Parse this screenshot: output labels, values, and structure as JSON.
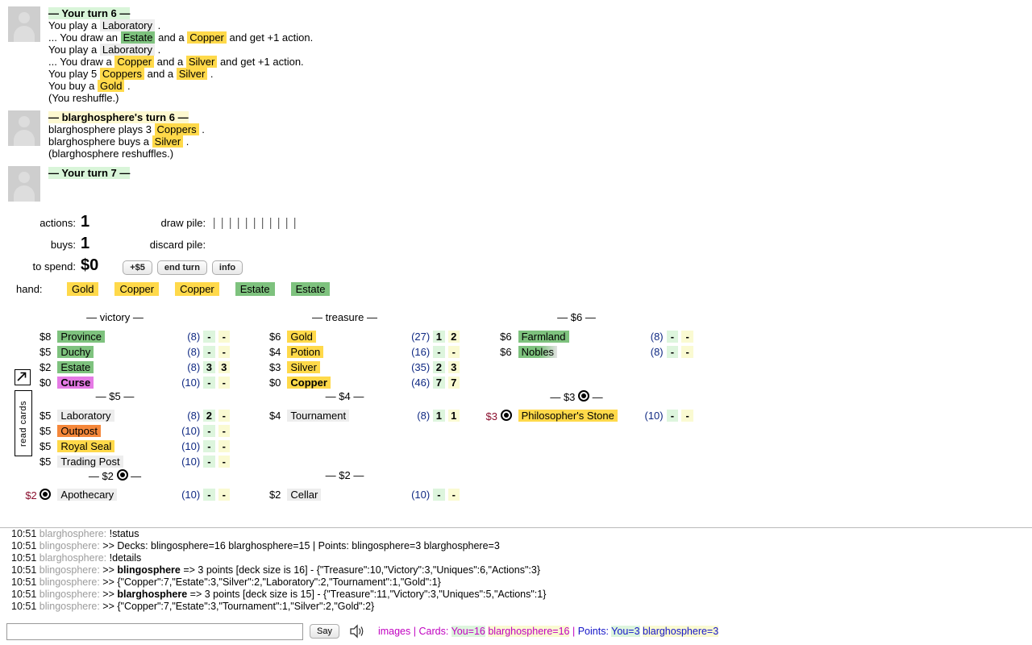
{
  "log": [
    {
      "avatar": "player-avatar",
      "header": {
        "text": "— Your turn 6 —",
        "style": "turn-you"
      },
      "lines": [
        [
          {
            "t": "You play a "
          },
          {
            "t": "Laboratory",
            "k": "action"
          },
          {
            "t": " ."
          }
        ],
        [
          {
            "t": "... You draw an "
          },
          {
            "t": "Estate",
            "k": "victory"
          },
          {
            "t": " and a "
          },
          {
            "t": "Copper",
            "k": "treasure"
          },
          {
            "t": " and get +1 action."
          }
        ],
        [
          {
            "t": "You play a "
          },
          {
            "t": "Laboratory",
            "k": "action"
          },
          {
            "t": " ."
          }
        ],
        [
          {
            "t": "... You draw a "
          },
          {
            "t": "Copper",
            "k": "treasure"
          },
          {
            "t": " and a "
          },
          {
            "t": "Silver",
            "k": "treasure"
          },
          {
            "t": " and get +1 action."
          }
        ],
        [
          {
            "t": "You play 5 "
          },
          {
            "t": "Coppers",
            "k": "treasure"
          },
          {
            "t": " and a "
          },
          {
            "t": "Silver",
            "k": "treasure"
          },
          {
            "t": " ."
          }
        ],
        [
          {
            "t": "You buy a "
          },
          {
            "t": "Gold",
            "k": "treasure"
          },
          {
            "t": " ."
          }
        ],
        [
          {
            "t": "(You reshuffle.)"
          }
        ]
      ]
    },
    {
      "avatar": "opponent-avatar",
      "header": {
        "text": "— blarghosphere's turn 6 —",
        "style": "turn-other"
      },
      "lines": [
        [
          {
            "t": "blarghosphere plays 3 "
          },
          {
            "t": "Coppers",
            "k": "treasure"
          },
          {
            "t": " ."
          }
        ],
        [
          {
            "t": "blarghosphere buys a "
          },
          {
            "t": "Silver",
            "k": "treasure"
          },
          {
            "t": " ."
          }
        ],
        [
          {
            "t": "(blarghosphere reshuffles.)"
          }
        ]
      ]
    },
    {
      "avatar": "player-avatar",
      "header": {
        "text": "— Your turn 7 —",
        "style": "turn-you"
      },
      "lines": []
    }
  ],
  "status": {
    "actions_label": "actions:",
    "actions_value": "1",
    "buys_label": "buys:",
    "buys_value": "1",
    "to_spend_label": "to spend:",
    "to_spend_value": "$0",
    "draw_pile_label": "draw pile:",
    "draw_pile_ticks": "|||||||||||",
    "discard_pile_label": "discard pile:",
    "discard_pile_ticks": "",
    "buttons": [
      {
        "label": "+$5",
        "name": "plus-five-button"
      },
      {
        "label": "end turn",
        "name": "end-turn-button"
      },
      {
        "label": "info",
        "name": "info-button"
      }
    ]
  },
  "hand": {
    "label": "hand:",
    "cards": [
      {
        "name": "Gold",
        "k": "treasure"
      },
      {
        "name": "Copper",
        "k": "treasure"
      },
      {
        "name": "Copper",
        "k": "treasure"
      },
      {
        "name": "Estate",
        "k": "victory"
      },
      {
        "name": "Estate",
        "k": "victory"
      }
    ]
  },
  "side_tab": {
    "label": "read cards",
    "popout_icon": "popout-arrow-icon"
  },
  "supply": {
    "sections": [
      {
        "title": "— victory —",
        "rows": [
          {
            "cost": "$8",
            "name": "Province",
            "k": "victory",
            "supply": "(8)",
            "a": "-",
            "b": "-"
          },
          {
            "cost": "$5",
            "name": "Duchy",
            "k": "victory",
            "supply": "(8)",
            "a": "-",
            "b": "-"
          },
          {
            "cost": "$2",
            "name": "Estate",
            "k": "victory",
            "supply": "(8)",
            "a": "3",
            "b": "3"
          },
          {
            "cost": "$0",
            "name": "Curse",
            "k": "curse",
            "supply": "(10)",
            "a": "-",
            "b": "-"
          }
        ]
      },
      {
        "title": "— treasure —",
        "rows": [
          {
            "cost": "$6",
            "name": "Gold",
            "k": "treasure",
            "supply": "(27)",
            "a": "1",
            "b": "2"
          },
          {
            "cost": "$4",
            "name": "Potion",
            "k": "treasure",
            "supply": "(16)",
            "a": "-",
            "b": "-"
          },
          {
            "cost": "$3",
            "name": "Silver",
            "k": "treasure",
            "supply": "(35)",
            "a": "2",
            "b": "3"
          },
          {
            "cost": "$0",
            "name": "Copper",
            "k": "copperbold",
            "supply": "(46)",
            "a": "7",
            "b": "7"
          }
        ]
      },
      {
        "title": "— $6 —",
        "rows": [
          {
            "cost": "$6",
            "name": "Farmland",
            "k": "victory",
            "supply": "(8)",
            "a": "-",
            "b": "-"
          },
          {
            "cost": "$6",
            "name": "Nobles",
            "k": "nobles",
            "supply": "(8)",
            "a": "-",
            "b": "-"
          }
        ]
      },
      {
        "title": "— $5 —",
        "rows": [
          {
            "cost": "$5",
            "name": "Laboratory",
            "k": "action",
            "supply": "(8)",
            "a": "2",
            "b": "-"
          },
          {
            "cost": "$5",
            "name": "Outpost",
            "k": "duration",
            "supply": "(10)",
            "a": "-",
            "b": "-"
          },
          {
            "cost": "$5",
            "name": "Royal Seal",
            "k": "treasure",
            "supply": "(10)",
            "a": "-",
            "b": "-"
          },
          {
            "cost": "$5",
            "name": "Trading Post",
            "k": "action",
            "supply": "(10)",
            "a": "-",
            "b": "-"
          }
        ]
      },
      {
        "title": "— $4 —",
        "rows": [
          {
            "cost": "$4",
            "name": "Tournament",
            "k": "action",
            "supply": "(8)",
            "a": "1",
            "b": "1"
          }
        ]
      },
      {
        "title": "— $3 ◉ —",
        "title_potion": true,
        "title_text": "— $3",
        "rows": [
          {
            "cost": "$3",
            "potion": true,
            "name": "Philosopher's Stone",
            "k": "treasure",
            "supply": "(10)",
            "a": "-",
            "b": "-"
          }
        ]
      },
      {
        "title": "— $2 ◉ —",
        "title_potion": true,
        "title_text": "— $2",
        "rows": [
          {
            "cost": "$2",
            "potion": true,
            "name": "Apothecary",
            "k": "action",
            "supply": "(10)",
            "a": "-",
            "b": "-"
          }
        ]
      },
      {
        "title": "— $2 —",
        "rows": [
          {
            "cost": "$2",
            "name": "Cellar",
            "k": "action",
            "supply": "(10)",
            "a": "-",
            "b": "-"
          }
        ]
      }
    ]
  },
  "chat": {
    "lines": [
      {
        "time": "10:51",
        "who": "blarghosphere:",
        "dim": true,
        "text": " !status"
      },
      {
        "time": "10:51",
        "who": "blingosphere:",
        "dim": true,
        "text": "  >> Decks:  blingosphere=16 blarghosphere=15 | Points:  blingosphere=3 blarghosphere=3"
      },
      {
        "time": "10:51",
        "who": "blarghosphere:",
        "dim": true,
        "text": " !details"
      },
      {
        "time": "10:51",
        "who": "blingosphere:",
        "dim": true,
        "text": " >> ",
        "bold": "blingosphere",
        "after": " => 3 points [deck size is 16] - {\"Treasure\":10,\"Victory\":3,\"Uniques\":6,\"Actions\":3}"
      },
      {
        "time": "10:51",
        "who": "blingosphere:",
        "dim": true,
        "text": " >>    {\"Copper\":7,\"Estate\":3,\"Silver\":2,\"Laboratory\":2,\"Tournament\":1,\"Gold\":1}"
      },
      {
        "time": "10:51",
        "who": "blingosphere:",
        "dim": true,
        "text": " >> ",
        "bold": "blarghosphere",
        "after": " => 3 points [deck size is 15] - {\"Treasure\":11,\"Victory\":3,\"Uniques\":5,\"Actions\":1}"
      },
      {
        "time": "10:51",
        "who": "blingosphere:",
        "dim": true,
        "text": " >>    {\"Copper\":7,\"Estate\":3,\"Tournament\":1,\"Silver\":2,\"Gold\":2}"
      }
    ]
  },
  "bottom": {
    "say_value": "",
    "say_placeholder": "",
    "say_button": "Say",
    "speaker_icon": "speaker-icon",
    "images_link": "images",
    "sep1": "|",
    "cards_label": "Cards:",
    "cards_you": "You=16",
    "cards_opp": "blarghosphere=16",
    "sep2": "|",
    "points_label": "Points:",
    "points_you": "You=3",
    "points_opp": "blarghosphere=3"
  },
  "colors": {
    "treasure": "#ffd94a",
    "victory": "#7ec27e",
    "action": "#ededed",
    "curse": "#e57ae5",
    "duration": "#f5873a",
    "turn_you": "#d9f5d9",
    "turn_other": "#fdf8d0",
    "count_a": "#ddf5dd",
    "count_b": "#fafad2",
    "supply_count_text": "#102a83",
    "link_magenta": "#c000c0",
    "points_blue": "#1414c8"
  }
}
